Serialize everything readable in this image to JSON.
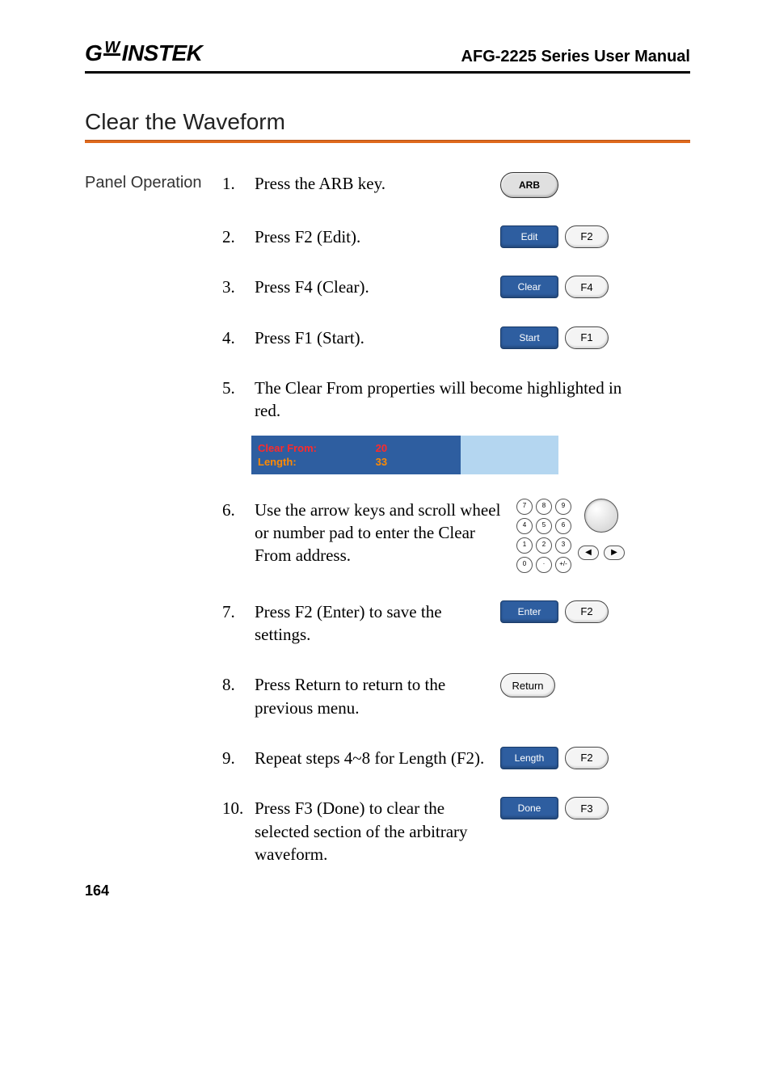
{
  "header": {
    "brand_letters": {
      "g": "G",
      "uw": "W",
      "instek": "INSTEK"
    },
    "manual_title": "AFG-2225 Series User Manual"
  },
  "section_title": "Clear the Waveform",
  "side_label": "Panel Operation",
  "keys": {
    "arb": "ARB",
    "edit": "Edit",
    "f2": "F2",
    "clear": "Clear",
    "f4": "F4",
    "start": "Start",
    "f1": "F1",
    "enter": "Enter",
    "return": "Return",
    "length": "Length",
    "done": "Done",
    "f3": "F3",
    "left_arrow": "◀",
    "right_arrow": "▶"
  },
  "numpad": [
    "7",
    "8",
    "9",
    "4",
    "5",
    "6",
    "1",
    "2",
    "3",
    "0",
    "·",
    "+/-"
  ],
  "prop_panel": {
    "clear_from_label": "Clear From:",
    "clear_from_value": "20",
    "length_label": "Length:",
    "length_value": "33"
  },
  "steps": {
    "s1": {
      "n": "1.",
      "t": "Press the ARB key."
    },
    "s2": {
      "n": "2.",
      "t": "Press F2 (Edit)."
    },
    "s3": {
      "n": "3.",
      "t": "Press F4 (Clear)."
    },
    "s4": {
      "n": "4.",
      "t": "Press F1 (Start)."
    },
    "s5": {
      "n": "5.",
      "t": "The Clear From properties will become highlighted in red."
    },
    "s6": {
      "n": "6.",
      "t": "Use the arrow keys and scroll wheel or number pad to enter the Clear From address."
    },
    "s7": {
      "n": "7.",
      "t": "Press F2 (Enter) to save the settings."
    },
    "s8": {
      "n": "8.",
      "t": "Press Return to return to the previous menu."
    },
    "s9": {
      "n": "9.",
      "t": "Repeat steps 4~8 for Length (F2)."
    },
    "s10": {
      "n": "10.",
      "t": "Press F3 (Done) to clear the selected section of the arbitrary waveform."
    }
  },
  "page_number": "164"
}
